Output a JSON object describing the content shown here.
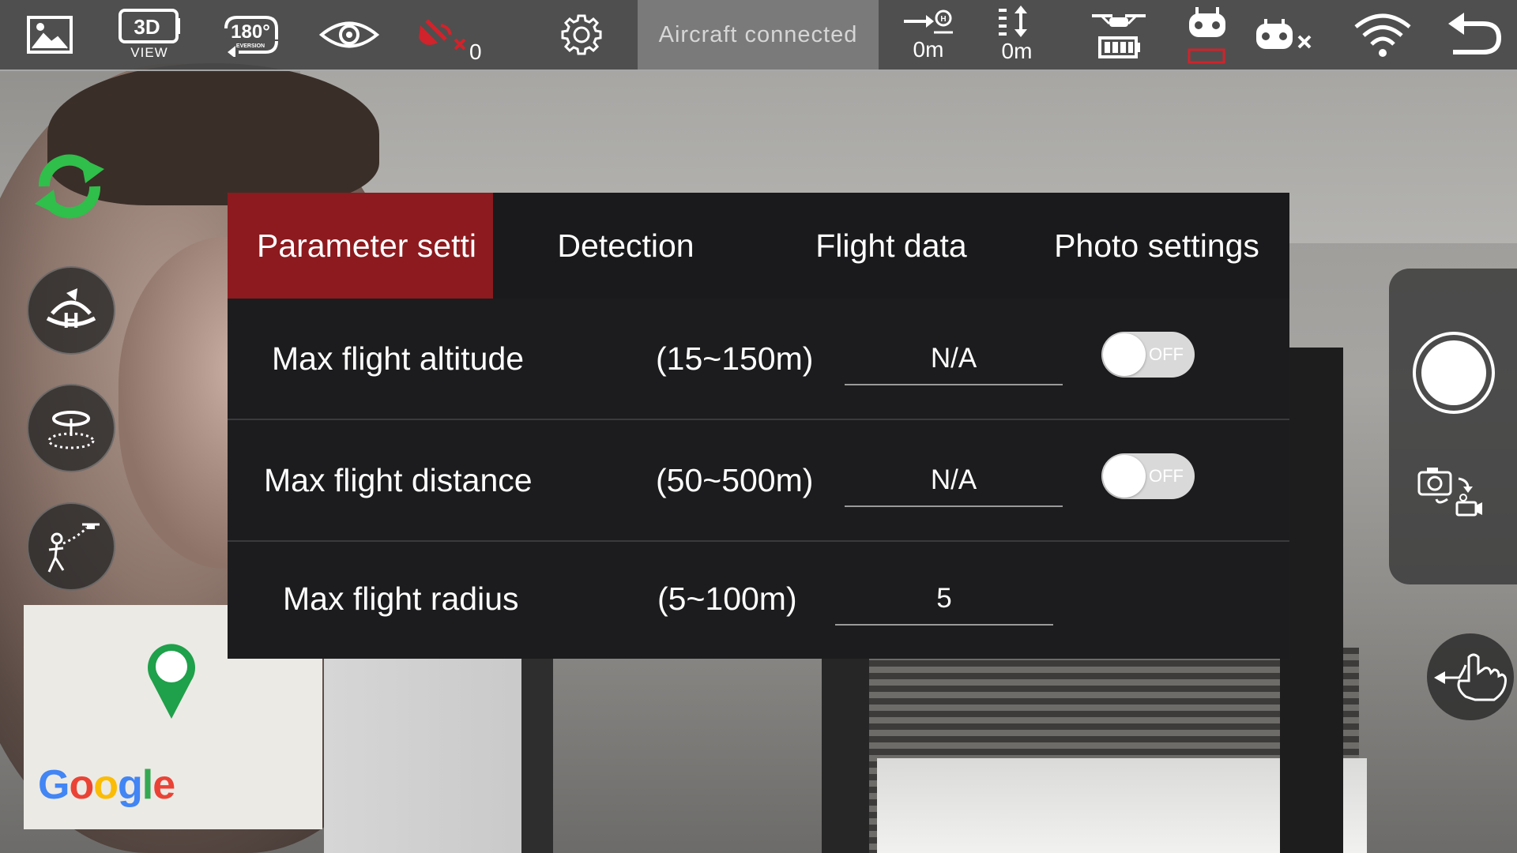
{
  "topbar": {
    "view_caption": "VIEW",
    "view_label": "3D",
    "inversion_label": "180°",
    "inversion_caption": "EVERSION",
    "gps_count": "0",
    "status": "Aircraft connected",
    "distance": "0m",
    "altitude": "0m"
  },
  "tabs": [
    {
      "label": "Parameter setti",
      "active": true
    },
    {
      "label": "Detection",
      "active": false
    },
    {
      "label": "Flight data",
      "active": false
    },
    {
      "label": "Photo settings",
      "active": false
    }
  ],
  "rows": [
    {
      "label": "Max flight altitude",
      "range": "(15~150m)",
      "value": "N/A",
      "toggle": "OFF"
    },
    {
      "label": "Max flight distance",
      "range": "(50~500m)",
      "value": "N/A",
      "toggle": "OFF"
    },
    {
      "label": "Max flight radius",
      "range": "(5~100m)",
      "value": "5"
    }
  ],
  "map": {
    "google": "Google"
  },
  "colors": {
    "active_tab": "#8c1a1e",
    "gps_warning": "#d0232b",
    "refresh_green": "#2fbf4a",
    "pin_green": "#1fa04a"
  }
}
